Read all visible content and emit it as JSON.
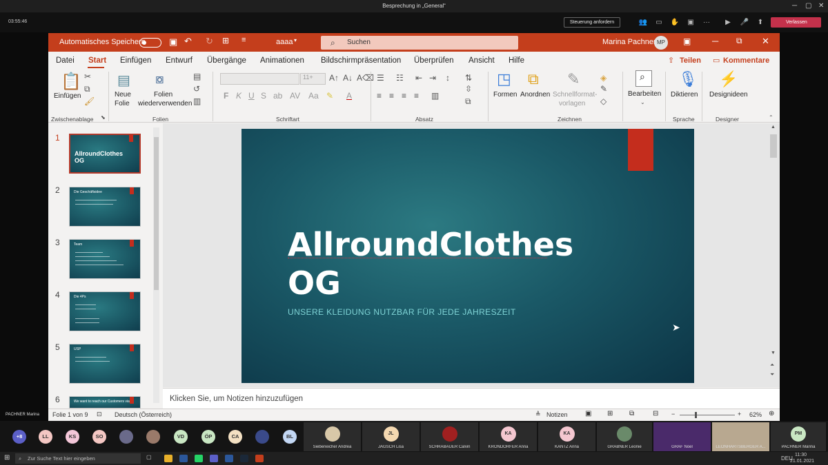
{
  "teams": {
    "title": "Besprechung in „General“",
    "timer": "03:55:46",
    "control_button": "Steuerung anfordern",
    "leave_button": "Verlassen"
  },
  "ppt": {
    "autosave_label": "Automatisches Speichern",
    "file_name": "aaaa",
    "search_placeholder": "Suchen",
    "user_name": "Marina Pachner",
    "user_initials": "MP",
    "menu": [
      "Datei",
      "Start",
      "Einfügen",
      "Entwurf",
      "Übergänge",
      "Animationen",
      "Bildschirmpräsentation",
      "Überprüfen",
      "Ansicht",
      "Hilfe"
    ],
    "share_label": "Teilen",
    "comments_label": "Kommentare",
    "ribbon": {
      "paste_label": "Einfügen",
      "clipboard_group": "Zwischenablage",
      "new_slide_line1": "Neue",
      "new_slide_line2": "Folie",
      "reuse_line1": "Folien",
      "reuse_line2": "wiederverwenden",
      "slides_group": "Folien",
      "font_size": "11+",
      "font_group": "Schriftart",
      "bold": "F",
      "italic": "K",
      "underline": "U",
      "strike": "S",
      "font_color": "A",
      "paragraph_group": "Absatz",
      "shapes_label": "Formen",
      "arrange_label": "Anordnen",
      "quickstyles_line1": "Schnellformat-",
      "quickstyles_line2": "vorlagen",
      "drawing_group": "Zeichnen",
      "edit_label": "Bearbeiten",
      "dictate_label": "Diktieren",
      "voice_group": "Sprache",
      "designer_label": "Designideen",
      "designer_group": "Designer"
    },
    "thumbnails": [
      {
        "num": "1",
        "title": "AllroundClothes OG"
      },
      {
        "num": "2",
        "title": "Die Geschäftsidee"
      },
      {
        "num": "3",
        "title": "Team"
      },
      {
        "num": "4",
        "title": "Die 4Ps"
      },
      {
        "num": "5",
        "title": "USP"
      },
      {
        "num": "6",
        "title": "We want to reach our Customers via"
      }
    ],
    "slide": {
      "title_line1": "AllroundClothes",
      "title_line2": "OG",
      "subtitle": "UNSERE KLEIDUNG NUTZBAR FÜR JEDE JAHRESZEIT"
    },
    "notes_placeholder": "Klicken Sie, um Notizen hinzuzufügen",
    "status": {
      "slide_info": "Folie 1 von 9",
      "language": "Deutsch (Österreich)",
      "notes_button": "Notizen",
      "zoom": "62%"
    }
  },
  "presenter_label": "PACHNER Marina",
  "participants": {
    "circles": [
      {
        "initials": "+8",
        "color": "#5b5fc7"
      },
      {
        "initials": "LL",
        "color": "#f4c7c3"
      },
      {
        "initials": "KS",
        "color": "#f4c7d9"
      },
      {
        "initials": "SO",
        "color": "#f4c7c3"
      },
      {
        "initials": "",
        "color": "#6a6a8a"
      },
      {
        "initials": "",
        "color": "#9a7a6a"
      },
      {
        "initials": "VD",
        "color": "#c9e7c3"
      },
      {
        "initials": "ÖP",
        "color": "#c9e7c3"
      },
      {
        "initials": "CA",
        "color": "#f4e1c3"
      },
      {
        "initials": "",
        "color": "#3a4a8a"
      },
      {
        "initials": "BL",
        "color": "#c3d7f4"
      }
    ],
    "tiles": [
      {
        "name": "Siebeneicher Andrea",
        "initials": "",
        "color": "#d8c8a8"
      },
      {
        "name": "JAGSCH Lisa",
        "initials": "JL",
        "color": "#f4d8b0"
      },
      {
        "name": "SCHRABAUER Calvin",
        "initials": "",
        "color": "#a02020"
      },
      {
        "name": "KRONDORFER Anna",
        "initials": "KA",
        "color": "#f4c7d0"
      },
      {
        "name": "KANTZ Anna",
        "initials": "KA",
        "color": "#f4c7d0"
      },
      {
        "name": "GRABNER Leonie",
        "initials": "",
        "color": "#6a8a6a"
      },
      {
        "name": "GRAF Noel",
        "initials": "",
        "color": "#4a2a6a"
      },
      {
        "name": "LEONHARTSBERGER A...",
        "initials": "",
        "color": "#b8a890"
      },
      {
        "name": "PACHNER Marina",
        "initials": "PM",
        "color": "#c9e7c3"
      }
    ]
  },
  "taskbar": {
    "search_placeholder": "Zur Suche Text hier eingeben",
    "language": "DEU",
    "time": "11:30",
    "date": "21.01.2021"
  }
}
